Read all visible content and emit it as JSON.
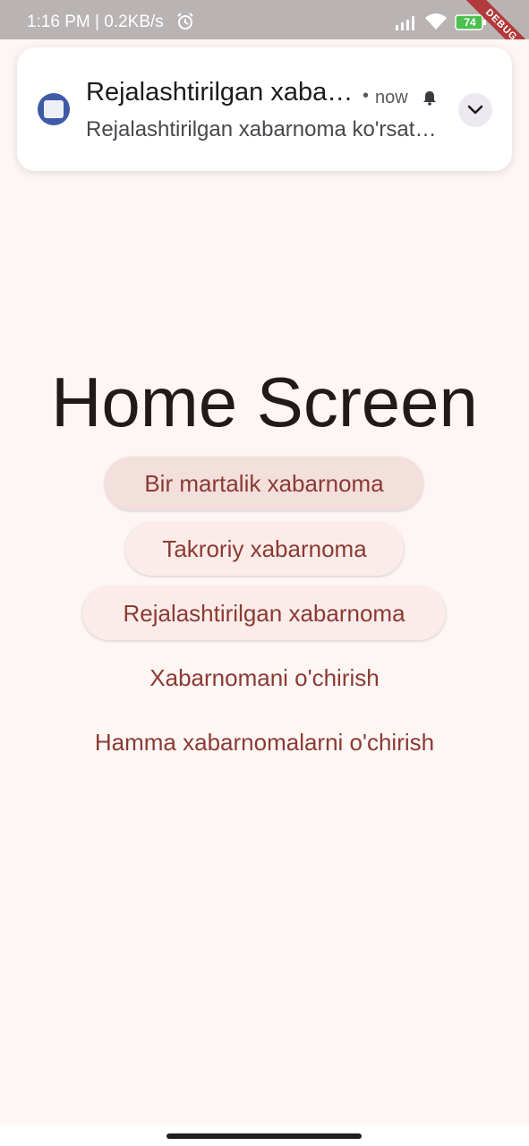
{
  "status_bar": {
    "time_speed": "1:16 PM | 0.2KB/s",
    "battery": "74",
    "debug_label": "DEBUG"
  },
  "notification": {
    "title": "Rejalashtirilgan xabarnoma",
    "separator": "•",
    "time": "now",
    "body": "Rejalashtirilgan xabarnoma ko'rsatildi"
  },
  "screen": {
    "title": "Home Screen",
    "buttons": [
      {
        "label": "Bir martalik xabarnoma"
      },
      {
        "label": "Takroriy xabarnoma"
      },
      {
        "label": "Rejalashtirilgan xabarnoma"
      },
      {
        "label": "Xabarnomani o'chirish"
      },
      {
        "label": "Hamma xabarnomalarni o'chirish"
      }
    ]
  },
  "colors": {
    "background": "#fdf6f5",
    "accent": "#8b3a33",
    "button_bg": "#fbece9",
    "status_bar": "#b9b3b3"
  }
}
